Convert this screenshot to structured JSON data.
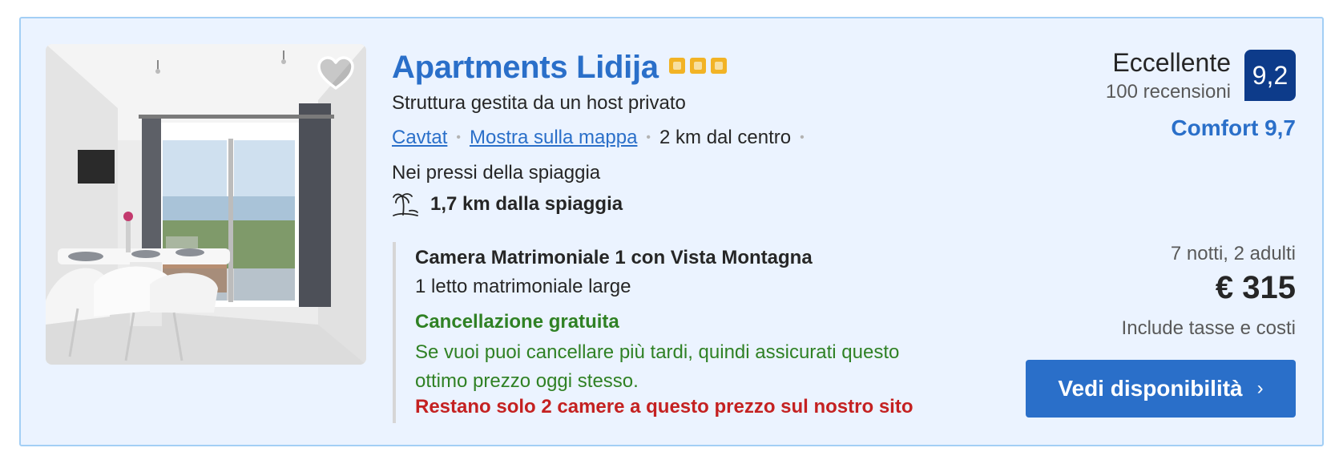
{
  "property": {
    "name": "Apartments Lidija",
    "star_rating": 3,
    "host_type": "Struttura gestita da un host privato",
    "city_link": "Cavtat",
    "map_link": "Mostra sulla mappa",
    "distance_center": "2 km dal centro",
    "beach_nearby": "Nei pressi della spiaggia",
    "beach_distance": "1,7 km dalla spiaggia",
    "icons": {
      "favorite": "heart-icon",
      "stars": "star-icon",
      "beach": "palm-tree-icon",
      "cta": "chevron-right-icon"
    }
  },
  "room": {
    "name": "Camera Matrimoniale 1 con Vista Montagna",
    "bed": "1 letto matrimoniale large",
    "cancellation_title": "Cancellazione gratuita",
    "cancellation_text": "Se vuoi puoi cancellare più tardi, quindi assicurati questo ottimo prezzo oggi stesso.",
    "scarcity": "Restano solo 2 camere a questo prezzo sul nostro sito"
  },
  "review": {
    "word": "Eccellente",
    "count": "100 recensioni",
    "score": "9,2",
    "comfort": "Comfort 9,7"
  },
  "pricing": {
    "stay": "7 notti, 2 adulti",
    "price": "€ 315",
    "taxes": "Include tasse e costi",
    "cta_label": "Vedi disponibilità",
    "cta_chevron": "›"
  },
  "colors": {
    "card_background": "#ebf3ff",
    "card_border": "#a3cff5",
    "link_blue": "#2a6fc9",
    "score_badge": "#0d3b8a",
    "star_yellow": "#f2b325",
    "green": "#2f8124",
    "red": "#c42121"
  }
}
